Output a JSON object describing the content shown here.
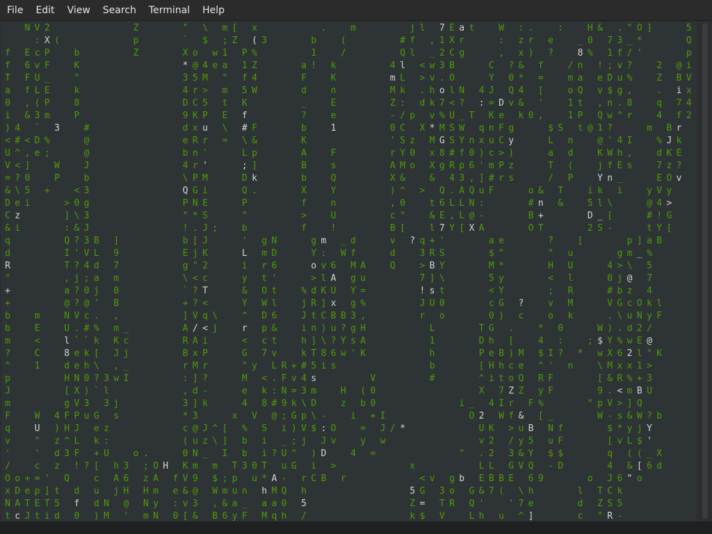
{
  "menubar": {
    "items": [
      "File",
      "Edit",
      "View",
      "Search",
      "Terminal",
      "Help"
    ]
  },
  "terminal": {
    "colors": {
      "background": "#2e3436",
      "glyph_green": "#4e9a06",
      "glyph_bright": "#d3d7cf"
    },
    "rows": [
      "  NV2        Z    \" \\ m[ x      .  m     jl 7Eat  W :.  :  H& .\"O]   5.",
      "   :X(       p    ` $ ;Z (3    b  (     #f ,1Xr   : zr e  _0 73_*    Q&",
      "f EcP  b     Z    Xo w1 P%     1  /     Ql _2Cg   , x) ?  8% 1f/'    pI",
      "f 6vF  K          *@4ea 1Z    a! k     4l <w3B   C ?& f  /n !;v?  2 @i",
      "T FU_  \"          35M \" f4    F  K     mL >v.O   Y 0* =  ma eDu%  Z BV",
      "a fLE  k          4r> m 5W    d  n     Mk .holN 4J Q4 [  oQ v$g,  . ix",
      "0 ,(P  8          DC5 t K     _  E     Z: dk7<? :=Dv& '  1t ,n.8  q 74",
      "i &3m  P          9KP E f     ?  e     -/p v%U_T Ke k0,  1P Qw^r  4 f2",
      ")4 ` 3  #         dxu \\ #F    b  1     0C X*MSW qnFg   $S t@1?   m Br",
      "<#<D%   @         eRr = \\&    K        'Sz MGSYnxuCy   L n  @'4I  %Jk",
      "U^,e;   @         bn'   Lp    A  F     rY0 x8#f0)c>)   a d  KWh,  dKE",
      "V<]  W  J         4r'   ;]    B  s     AMo XgRp6'mPz   T (  jfEs  7z?",
      "=?0  P  b         \\PM   Dk    b  Q     X&  & 43,]#rs   / P  Yn_   EOv",
      "&\\5 +  <3         QGi   Q.    X  Y     )^ > Q.AQuF   o& T  ik i  yVy",
      "Dei   >0g         PNE   P     f  n     ,0  t6LLN:    #n &  5l\\   @4>",
      "Cz    ]\\3         \"*S   \"     >  U     c\"  &E,L@-    B+    D_[   #!G",
      "&i    :&J         !.J;  b     f  !     B[  l7Y[XA    OT    2S-   tY[",
      "q     Q?3B ]      b[J   ' gN   gm _d   v ?q+'    ae    ?  [    p]aB",
      "d     I'VL 9      EjK   L mD   Y: Wf   d  3RS    $\"    \" u    gm_%",
      "R     T?4d 7      g\"2   i r6   ov6 MA  Q  >BY    M*    H U   4>\\ 5",
      "\"     ,j;a m      \\<c   y t'   >lA gu     7]\\    5y    < l   0j@ 7",
      "+     a?0j 0      `?T   & Ot  %dKU Y=     !st    <Y    ; R   #bz 4",
      "+     @?@' B      +?<   Y Wl  jR]x g%     JU0    cG ?  v M   VGcOkl",
      "b  m  NVc. ,      ]Vq\\  ^ D6  JtCBB3,     r o    0) c  o k   .\\uNyF",
      "b  E  U.#% m_     A/<j  r p&  in)u?gH      L    TG .  * 0   W).d2/",
      "m  <  l``k Kc     RAi   < ct  h]\\?YsA      1    Dh [  4 :  ;$Y%wE@",
      "?  C  8ek[ Jj     BxP   G 7v  kT86w'K      h    PeB)M $I? * wX62l\"K",
      "^  1  deh\\ ,_     rMr   \"y LR+#5is         b    [Hhce ^' n  \\Mxx1>",
      "p     HN0?3wI     :]?   M <.Fv4s     V     #    ^itoQ RF    [&R%+3",
      "J     [X)`l       ,d-   e k:N=3m  H (0          X 7ZZ yF    9.<mBU",
      "m     gV3 3j      3]k   4 8#9k\\D  z b0        i_ 4Ir F%    \"pV>]Q",
      "F  W 4FPuG s      *3   x V @;Gp\\-  i +I        O2 Wf& [_    W-s&W?b",
      "q  U )HJ ez       c@J^[ % S i)V$:O  = J/*       UK >uB Nf    $*yjY",
      "v  \" z^L k:       (uz\\] b i _;j Jv  y w         v2 /y5 uF    [vL$'",
      "'  ' d3F +U  o.   0N_ I b i?U^ )D  4 =        \" .2 3&Y $$    q ((_X",
      "/  c z !?[ h3 ;OH Km m T30T uG i >       x      LL GVQ -D    4 &[6d",
      "Oo+=' Q  c A6 zA fV9 $;p u*A- rCB r       <v gb EBBE 69    o J6\"o",
      "xDep]t d u jH Hm e&@ Wmun hMQ h          5G 3o G&7( \\h    l TCk",
      "NATET5 f dN @ Ny :v3 ,&a_ aa0 5          Z= TR Q'  '7e    d ZS5",
      "tcJtid 0 )M ' mN 0[& B6yF Mqh /          k$ V  Lh u ^]    c \"R-"
    ]
  }
}
